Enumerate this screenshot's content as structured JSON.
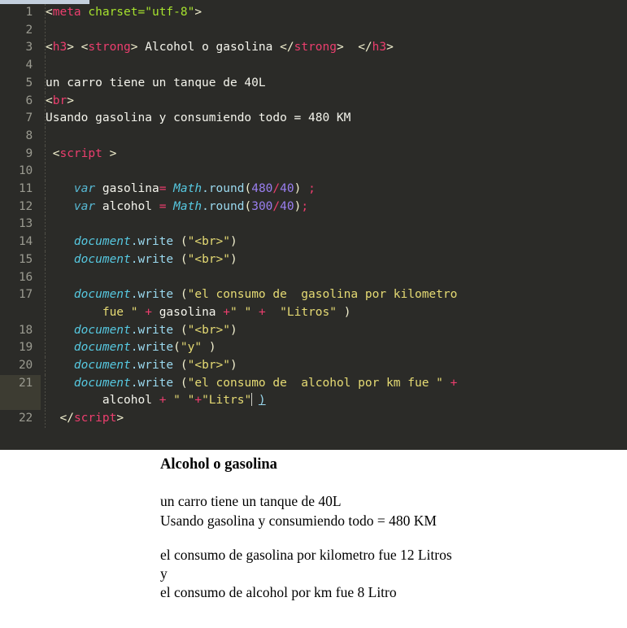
{
  "editor": {
    "theme_colors": {
      "background": "#2b2b28",
      "gutter_text": "#9a9a90",
      "active_line": "#3d3c32",
      "tag_name": "#ec3e6e",
      "attribute": "#a6e22e",
      "string": "#e6db74",
      "number": "#9a7ff0",
      "operator": "#ec3e6e",
      "keyword": "#57b9d4",
      "object": "#56c8e0",
      "plain_text": "#f4f4ec"
    },
    "language": "HTML",
    "active_line_number": "21",
    "lines": [
      {
        "n": "1",
        "tokens": [
          {
            "t": "tagpunc",
            "v": "<"
          },
          {
            "t": "tagname",
            "v": "meta"
          },
          {
            "t": "plain",
            "v": " "
          },
          {
            "t": "attr",
            "v": "charset"
          },
          {
            "t": "attrval",
            "v": "=\"utf-8\""
          },
          {
            "t": "tagpunc",
            "v": ">"
          }
        ]
      },
      {
        "n": "2",
        "tokens": []
      },
      {
        "n": "3",
        "tokens": [
          {
            "t": "tagpunc",
            "v": "<"
          },
          {
            "t": "tagname",
            "v": "h3"
          },
          {
            "t": "tagpunc",
            "v": ">"
          },
          {
            "t": "plain",
            "v": " "
          },
          {
            "t": "tagpunc",
            "v": "<"
          },
          {
            "t": "tagname",
            "v": "strong"
          },
          {
            "t": "tagpunc",
            "v": ">"
          },
          {
            "t": "plain",
            "v": " Alcohol o gasolina "
          },
          {
            "t": "tagpunc",
            "v": "</"
          },
          {
            "t": "tagname",
            "v": "strong"
          },
          {
            "t": "tagpunc",
            "v": ">"
          },
          {
            "t": "plain",
            "v": "  "
          },
          {
            "t": "tagpunc",
            "v": "</"
          },
          {
            "t": "tagname",
            "v": "h3"
          },
          {
            "t": "tagpunc",
            "v": ">"
          }
        ]
      },
      {
        "n": "4",
        "tokens": []
      },
      {
        "n": "5",
        "tokens": [
          {
            "t": "plain",
            "v": "un carro tiene un tanque de 40L"
          }
        ]
      },
      {
        "n": "6",
        "tokens": [
          {
            "t": "tagpunc",
            "v": "<"
          },
          {
            "t": "tagname",
            "v": "br"
          },
          {
            "t": "tagpunc",
            "v": ">"
          }
        ]
      },
      {
        "n": "7",
        "tokens": [
          {
            "t": "plain",
            "v": "Usando gasolina y consumiendo todo = 480 KM"
          }
        ]
      },
      {
        "n": "8",
        "tokens": []
      },
      {
        "n": "9",
        "tokens": [
          {
            "t": "plain",
            "v": " "
          },
          {
            "t": "tagpunc",
            "v": "<"
          },
          {
            "t": "tagname",
            "v": "script"
          },
          {
            "t": "plain",
            "v": " "
          },
          {
            "t": "tagpunc",
            "v": ">"
          }
        ]
      },
      {
        "n": "10",
        "tokens": []
      },
      {
        "n": "11",
        "tokens": [
          {
            "t": "plain",
            "v": "    "
          },
          {
            "t": "kw",
            "v": "var"
          },
          {
            "t": "var",
            "v": " gasolina"
          },
          {
            "t": "op",
            "v": "="
          },
          {
            "t": "var",
            "v": " "
          },
          {
            "t": "obj",
            "v": "Math"
          },
          {
            "t": "prop",
            "v": ".round"
          },
          {
            "t": "punct",
            "v": "("
          },
          {
            "t": "num",
            "v": "480"
          },
          {
            "t": "op",
            "v": "/"
          },
          {
            "t": "num",
            "v": "40"
          },
          {
            "t": "punct",
            "v": ")"
          },
          {
            "t": "var",
            "v": " "
          },
          {
            "t": "op",
            "v": ";"
          }
        ]
      },
      {
        "n": "12",
        "tokens": [
          {
            "t": "plain",
            "v": "    "
          },
          {
            "t": "kw",
            "v": "var"
          },
          {
            "t": "var",
            "v": " alcohol "
          },
          {
            "t": "op",
            "v": "="
          },
          {
            "t": "var",
            "v": " "
          },
          {
            "t": "obj",
            "v": "Math"
          },
          {
            "t": "prop",
            "v": ".round"
          },
          {
            "t": "punct",
            "v": "("
          },
          {
            "t": "num",
            "v": "300"
          },
          {
            "t": "op",
            "v": "/"
          },
          {
            "t": "num",
            "v": "40"
          },
          {
            "t": "punct",
            "v": ")"
          },
          {
            "t": "op",
            "v": ";"
          }
        ]
      },
      {
        "n": "13",
        "tokens": []
      },
      {
        "n": "14",
        "tokens": [
          {
            "t": "plain",
            "v": "    "
          },
          {
            "t": "obj",
            "v": "document"
          },
          {
            "t": "prop",
            "v": ".write"
          },
          {
            "t": "var",
            "v": " "
          },
          {
            "t": "punct",
            "v": "("
          },
          {
            "t": "str",
            "v": "\"<br>\""
          },
          {
            "t": "punct",
            "v": ")"
          }
        ]
      },
      {
        "n": "15",
        "tokens": [
          {
            "t": "plain",
            "v": "    "
          },
          {
            "t": "obj",
            "v": "document"
          },
          {
            "t": "prop",
            "v": ".write"
          },
          {
            "t": "var",
            "v": " "
          },
          {
            "t": "punct",
            "v": "("
          },
          {
            "t": "str",
            "v": "\"<br>\""
          },
          {
            "t": "punct",
            "v": ")"
          }
        ]
      },
      {
        "n": "16",
        "tokens": []
      },
      {
        "n": "17",
        "tokens": [
          {
            "t": "plain",
            "v": "    "
          },
          {
            "t": "obj",
            "v": "document"
          },
          {
            "t": "prop",
            "v": ".write"
          },
          {
            "t": "var",
            "v": " "
          },
          {
            "t": "punct",
            "v": "("
          },
          {
            "t": "str",
            "v": "\"el consumo de  gasolina por kilometro"
          },
          {
            "t": "plain",
            "v": "\n        "
          },
          {
            "t": "str",
            "v": "fue \""
          },
          {
            "t": "var",
            "v": " "
          },
          {
            "t": "op",
            "v": "+"
          },
          {
            "t": "var",
            "v": " gasolina "
          },
          {
            "t": "op",
            "v": "+"
          },
          {
            "t": "str",
            "v": "\" \""
          },
          {
            "t": "var",
            "v": " "
          },
          {
            "t": "op",
            "v": "+"
          },
          {
            "t": "str",
            "v": "  \"Litros\""
          },
          {
            "t": "var",
            "v": " "
          },
          {
            "t": "punct",
            "v": ")"
          }
        ]
      },
      {
        "n": "18",
        "tokens": [
          {
            "t": "plain",
            "v": "    "
          },
          {
            "t": "obj",
            "v": "document"
          },
          {
            "t": "prop",
            "v": ".write"
          },
          {
            "t": "var",
            "v": " "
          },
          {
            "t": "punct",
            "v": "("
          },
          {
            "t": "str",
            "v": "\"<br>\""
          },
          {
            "t": "punct",
            "v": ")"
          }
        ]
      },
      {
        "n": "19",
        "tokens": [
          {
            "t": "plain",
            "v": "    "
          },
          {
            "t": "obj",
            "v": "document"
          },
          {
            "t": "prop",
            "v": ".write"
          },
          {
            "t": "punct",
            "v": "("
          },
          {
            "t": "str",
            "v": "\"y\""
          },
          {
            "t": "var",
            "v": " "
          },
          {
            "t": "punct",
            "v": ")"
          }
        ]
      },
      {
        "n": "20",
        "tokens": [
          {
            "t": "plain",
            "v": "    "
          },
          {
            "t": "obj",
            "v": "document"
          },
          {
            "t": "prop",
            "v": ".write"
          },
          {
            "t": "var",
            "v": " "
          },
          {
            "t": "punct",
            "v": "("
          },
          {
            "t": "str",
            "v": "\"<br>\""
          },
          {
            "t": "punct",
            "v": ")"
          }
        ]
      },
      {
        "n": "21",
        "tokens": [
          {
            "t": "plain",
            "v": "    "
          },
          {
            "t": "obj",
            "v": "document"
          },
          {
            "t": "prop",
            "v": ".write"
          },
          {
            "t": "var",
            "v": " "
          },
          {
            "t": "punct",
            "v": "("
          },
          {
            "t": "str",
            "v": "\"el consumo de  alcohol por km fue \""
          },
          {
            "t": "var",
            "v": " "
          },
          {
            "t": "op",
            "v": "+"
          },
          {
            "t": "plain",
            "v": "\n        "
          },
          {
            "t": "var",
            "v": "alcohol "
          },
          {
            "t": "op",
            "v": "+"
          },
          {
            "t": "str",
            "v": " \" \""
          },
          {
            "t": "op",
            "v": "+"
          },
          {
            "t": "str",
            "v": "\"Litrs\""
          },
          {
            "t": "caret",
            "v": ""
          },
          {
            "t": "var",
            "v": " "
          },
          {
            "t": "brkt",
            "v": ")"
          }
        ]
      },
      {
        "n": "22",
        "tokens": [
          {
            "t": "plain",
            "v": "  "
          },
          {
            "t": "tagpunc",
            "v": "</"
          },
          {
            "t": "tagname",
            "v": "script"
          },
          {
            "t": "tagpunc",
            "v": ">"
          }
        ]
      }
    ]
  },
  "output": {
    "title": "Alcohol o gasolina",
    "lines": [
      "un carro tiene un tanque de 40L",
      "Usando gasolina y consumiendo todo = 480 KM",
      "",
      "el consumo de gasolina por kilometro fue 12 Litros",
      "y",
      "el consumo de alcohol por km fue 8 Litro"
    ]
  }
}
